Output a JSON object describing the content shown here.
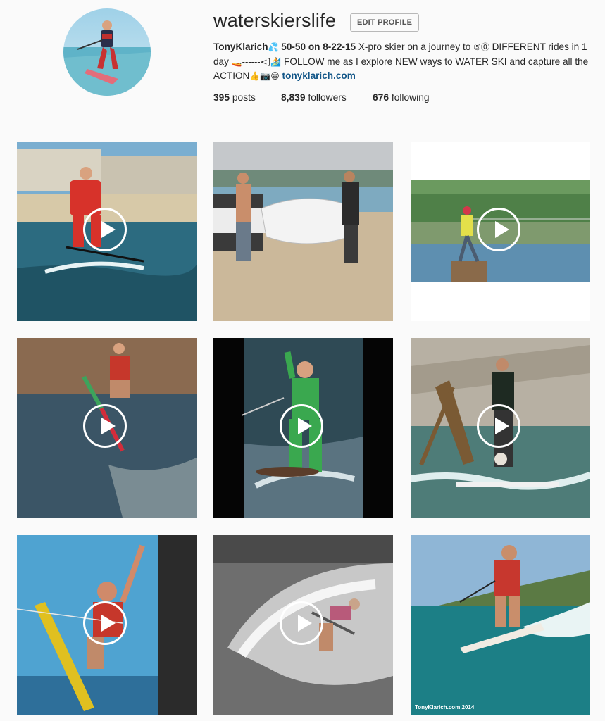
{
  "profile": {
    "username": "waterskierslife",
    "edit_button": "EDIT PROFILE",
    "bio_name": "TonyKlarich",
    "bio_emoji_1": "💦",
    "bio_highlight": "50-50 on 8-22-15",
    "bio_text_1": " X-pro skier on a journey to ",
    "bio_circled": "⑤⓪",
    "bio_text_2": " DIFFERENT rides in 1 day ",
    "bio_emoji_2": "🚤------<]🏄",
    "bio_text_3": " FOLLOW me as I explore NEW ways to WATER SKI and capture all the ACTION",
    "bio_emoji_3": "👍📷😀",
    "bio_link": "tonyklarich.com",
    "avatar_icon": "profile-avatar"
  },
  "stats": {
    "posts_count": "395",
    "posts_label": " posts",
    "followers_count": "8,839",
    "followers_label": " followers",
    "following_count": "676",
    "following_label": " following"
  },
  "posts": [
    {
      "kind": "video",
      "subject": "skier in red suit on beach water"
    },
    {
      "kind": "image",
      "subject": "men holding car hood on beach"
    },
    {
      "kind": "video",
      "subject": "skier on wooden stump"
    },
    {
      "kind": "video",
      "subject": "skier on trick ski"
    },
    {
      "kind": "video",
      "subject": "skier in green suit"
    },
    {
      "kind": "video",
      "subject": "skier on ladder with dog"
    },
    {
      "kind": "video",
      "subject": "skier on yellow board"
    },
    {
      "kind": "video",
      "subject": "skier spraying water"
    },
    {
      "kind": "video",
      "subject": "skier on wakeboard",
      "watermark": "TonyKlarich.com 2014"
    }
  ],
  "colors": {
    "link": "#125688",
    "text": "#262626",
    "background": "#fafafa"
  }
}
